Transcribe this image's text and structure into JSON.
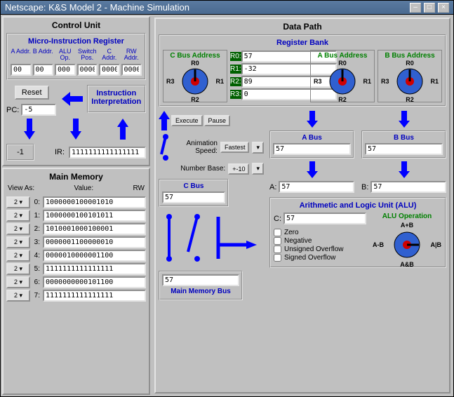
{
  "window": {
    "title": "Netscape: K&S Model 2 - Machine Simulation"
  },
  "control_unit": {
    "title": "Control Unit",
    "mir_title": "Micro-Instruction Register",
    "cols": [
      {
        "label": "A Addr.",
        "value": "00"
      },
      {
        "label": "B Addr.",
        "value": "00"
      },
      {
        "label": "ALU Op.",
        "value": "000"
      },
      {
        "label": "Switch Pos.",
        "value": "0000"
      },
      {
        "label": "C Addr.",
        "value": "0000"
      },
      {
        "label": "RW Addr.",
        "value": "0000"
      }
    ],
    "reset_label": "Reset",
    "pc_label": "PC:",
    "pc_value": "-5",
    "ii_label": "Instruction Interpretation",
    "neg1": "-1",
    "ir_label": "IR:",
    "ir_value": "1111111111111111"
  },
  "memory": {
    "title": "Main Memory",
    "viewas": "View As:",
    "value_lbl": "Value:",
    "rw_lbl": "RW",
    "base_btn": "2",
    "rows": [
      {
        "idx": "0:",
        "val": "1000000100001010"
      },
      {
        "idx": "1:",
        "val": "1000000100101011"
      },
      {
        "idx": "2:",
        "val": "1010001000100001"
      },
      {
        "idx": "3:",
        "val": "0000001100000010"
      },
      {
        "idx": "4:",
        "val": "0000010000001100"
      },
      {
        "idx": "5:",
        "val": "1111111111111111"
      },
      {
        "idx": "6:",
        "val": "0000000000101100"
      },
      {
        "idx": "7:",
        "val": "1111111111111111"
      }
    ]
  },
  "datapath": {
    "title": "Data Path",
    "regbank_title": "Register Bank",
    "cbus_label": "C Bus Address",
    "abus_label": "A Bus Address",
    "bbus_label": "B Bus Address",
    "regs": [
      {
        "name": "R0:",
        "val": "57"
      },
      {
        "name": "R1:",
        "val": "-32"
      },
      {
        "name": "R2:",
        "val": "89"
      },
      {
        "name": "R3:",
        "val": "0"
      }
    ],
    "dial_labels": {
      "r0": "R0",
      "r1": "R1",
      "r2": "R2",
      "r3": "R3"
    },
    "execute": "Execute",
    "pause": "Pause",
    "anim_label": "Animation Speed:",
    "anim_value": "Fastest",
    "base_label": "Number Base:",
    "base_value": "+-10",
    "abus": "A Bus",
    "bbus": "B Bus",
    "cbus": "C Bus",
    "mmbus": "Main Memory Bus",
    "abus_val": "57",
    "bbus_val": "57",
    "cbus_val": "57",
    "mmbus_val": "57",
    "ab_a_lbl": "A:",
    "ab_a_val": "57",
    "ab_b_lbl": "B:",
    "ab_b_val": "57",
    "alu_title": "Arithmetic and Logic Unit (ALU)",
    "alu_c_lbl": "C:",
    "alu_c_val": "57",
    "alu_op_lbl": "ALU Operation",
    "flags": [
      "Zero",
      "Negative",
      "Unsigned Overflow",
      "Signed Overflow"
    ],
    "alu_ops": {
      "top": "A+B",
      "right": "A|B",
      "bottom": "A&B",
      "left": "A-B"
    }
  }
}
